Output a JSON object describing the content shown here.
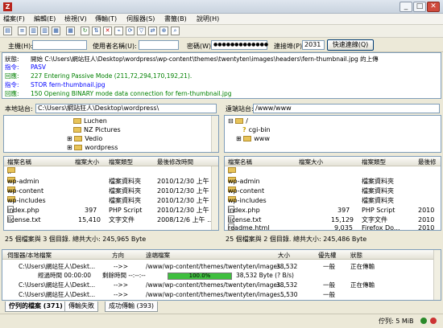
{
  "window": {
    "title": "FileZilla",
    "minimize": "_",
    "maximize": "□",
    "close": "✕"
  },
  "menu": [
    "檔案(F)",
    "編輯(E)",
    "檢視(V)",
    "傳輸(T)",
    "伺服器(S)",
    "書籤(B)",
    "說明(H)"
  ],
  "toolbar_icons": [
    "site-manager-icon",
    "toggle-log-icon",
    "toggle-tree-local-icon",
    "toggle-tree-remote-icon",
    "toggle-queue-icon",
    "refresh-icon",
    "process-queue-icon",
    "cancel-icon",
    "disconnect-icon",
    "reconnect-icon",
    "filter-icon",
    "compare-icon",
    "sync-browse-icon",
    "search-icon"
  ],
  "quickconnect": {
    "host_label": "主機(H):",
    "host_value": "",
    "user_label": "使用者名稱(U):",
    "user_value": "",
    "pass_label": "密碼(W):",
    "pass_value": "●●●●●●●●●●●●●",
    "port_label": "連接埠(P):",
    "port_value": "2031",
    "button": "快速連線(Q)"
  },
  "log": [
    {
      "key": "狀態:",
      "text": "開始 C:\\Users\\網站狂人\\Desktop\\wordpress\\wp-content\\themes\\twentyten\\images\\headers\\fern-thumbnail.jpg 的上傳",
      "color": "#000000"
    },
    {
      "key": "指令:",
      "text": "PASV",
      "color": "#0000ff"
    },
    {
      "key": "回應:",
      "text": "227 Entering Passive Mode (211,72,294,170,192,21).",
      "color": "#008000"
    },
    {
      "key": "指令:",
      "text": "STOR fern-thumbnail.jpg",
      "color": "#0000ff"
    },
    {
      "key": "回應:",
      "text": "150 Opening BINARY mode data connection for fern-thumbnail.jpg",
      "color": "#008000"
    }
  ],
  "local": {
    "label": "本地站台:",
    "path": "C:\\Users\\網站狂人\\Desktop\\wordpress\\",
    "tree": [
      "Luchen",
      "NZ Pictures",
      "Vedio",
      "wordpress"
    ],
    "headers": [
      "檔案名稱",
      "檔案大小",
      "檔案類型",
      "最後修改時間"
    ],
    "files": [
      {
        "name": "..",
        "size": "",
        "type": "",
        "modified": ""
      },
      {
        "name": "wp-admin",
        "size": "",
        "type": "檔案資料夾",
        "modified": "2010/12/30 上午 ..."
      },
      {
        "name": "wp-content",
        "size": "",
        "type": "檔案資料夾",
        "modified": "2010/12/30 上午 ..."
      },
      {
        "name": "wp-includes",
        "size": "",
        "type": "檔案資料夾",
        "modified": "2010/12/30 上午 ..."
      },
      {
        "name": "index.php",
        "size": "397",
        "type": "PHP Script",
        "modified": "2010/12/30 上午 ..."
      },
      {
        "name": "license.txt",
        "size": "15,410",
        "type": "文字文件",
        "modified": "2008/12/6 上午 ..."
      }
    ],
    "status": "25 個檔案與 3 個目錄. 總共大小: 245,965 Byte"
  },
  "remote": {
    "label": "遠端站台:",
    "path": "/www/www",
    "tree": [
      "/",
      "cgi-bin",
      "www"
    ],
    "headers": [
      "檔案名稱",
      "檔案大小",
      "檔案類型",
      "最後修"
    ],
    "files": [
      {
        "name": "..",
        "size": "",
        "type": "",
        "modified": ""
      },
      {
        "name": "wp-admin",
        "size": "",
        "type": "檔案資料夾",
        "modified": ""
      },
      {
        "name": "wp-content",
        "size": "",
        "type": "檔案資料夾",
        "modified": ""
      },
      {
        "name": "wp-includes",
        "size": "",
        "type": "檔案資料夾",
        "modified": ""
      },
      {
        "name": "index.php",
        "size": "397",
        "type": "PHP Script",
        "modified": "2010"
      },
      {
        "name": "license.txt",
        "size": "15,129",
        "type": "文字文件",
        "modified": "2010"
      },
      {
        "name": "readme.html",
        "size": "9,035",
        "type": "Firefox Do...",
        "modified": "2010"
      }
    ],
    "status": "25 個檔案與 2 個目錄. 總共大小: 245,486 Byte"
  },
  "queue": {
    "headers": [
      "伺服器/本地檔案",
      "方向",
      "遠端檔案",
      "大小",
      "優先權",
      "狀態"
    ],
    "rows": [
      {
        "local": "C:\\Users\\網站狂人\\Deskt...",
        "dir": "-->>",
        "remote": "/www/wp-content/themes/twentyten/images...",
        "size": "38,532",
        "priority": "一般",
        "status": "正在傳輸"
      },
      {
        "local": "經過時間 00:00:00",
        "dir": "剩餘時間 --:--:--",
        "remote": "",
        "size": "38,532 Byte (? B/s)",
        "priority": "",
        "status": ""
      },
      {
        "local": "C:\\Users\\網站狂人\\Deskt...",
        "dir": "-->>",
        "remote": "/www/wp-content/themes/twentyten/images...",
        "size": "38,532",
        "priority": "一般",
        "status": "正在傳輸"
      },
      {
        "local": "C:\\Users\\網站狂人\\Deskt...",
        "dir": "-->>",
        "remote": "/www/wp-content/themes/twentyten/images...",
        "size": "5,530",
        "priority": "一般",
        "status": ""
      }
    ],
    "progress_percent": 100,
    "progress_label": "100.0%"
  },
  "tabs": [
    "佇列的檔案 (371)",
    "傳輸失敗",
    "成功傳輸 (393)"
  ],
  "statusbar": {
    "queue_label": "佇列: 5 MiB"
  }
}
